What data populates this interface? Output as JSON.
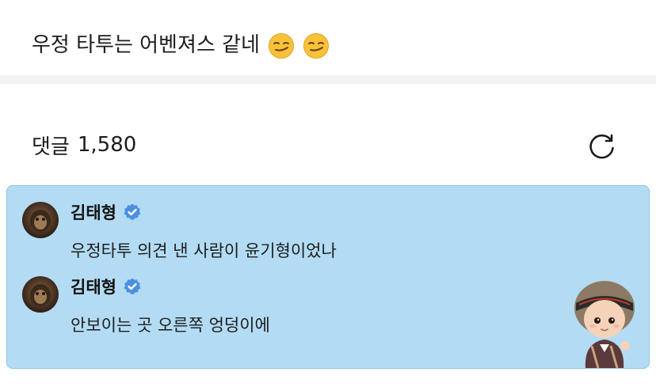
{
  "post": {
    "text": "우정 타투는 어벤져스 같네",
    "emojis": [
      "smirking-face",
      "smirking-face"
    ]
  },
  "comments_section": {
    "label": "댓글",
    "count": "1,580",
    "refresh_icon": "refresh-icon"
  },
  "highlighted_comments": [
    {
      "author": "김태형",
      "verified": true,
      "text": "우정타투 의견 낸 사람이 윤기형이었나"
    },
    {
      "author": "김태형",
      "verified": true,
      "text": "안보이는 곳 오른쪽 엉덩이에"
    }
  ],
  "colors": {
    "highlight_bg": "#b3dcf4",
    "highlight_border": "#8ec3e6",
    "verified_badge": "#4a90e2",
    "divider": "#f3f3f5"
  }
}
